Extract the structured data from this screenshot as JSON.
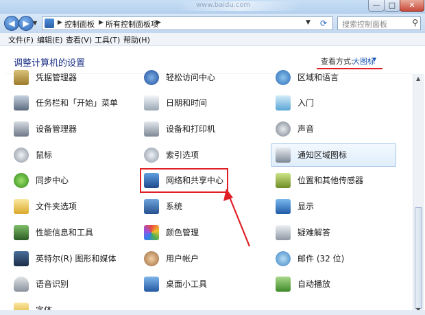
{
  "window": {
    "blurred_title": "www.baidu.com",
    "controls": {
      "minimize": "—",
      "maximize": "□",
      "close": "✕"
    }
  },
  "address_bar": {
    "crumbs": [
      "控制面板",
      "所有控制面板项"
    ],
    "search_placeholder": "搜索控制面板"
  },
  "menu": [
    "文件(F)",
    "编辑(E)",
    "查看(V)",
    "工具(T)",
    "帮助(H)"
  ],
  "page": {
    "heading": "调整计算机的设置",
    "view_by_label": "查看方式:",
    "view_by_value": "大图标"
  },
  "items": {
    "c1": [
      "凭据管理器",
      "任务栏和「开始」菜单",
      "设备管理器",
      "鼠标",
      "同步中心",
      "文件夹选项",
      "性能信息和工具",
      "英特尔(R) 图形和媒体",
      "语音识别",
      "字体"
    ],
    "c2": [
      "轻松访问中心",
      "日期和时间",
      "设备和打印机",
      "索引选项",
      "网络和共享中心",
      "系统",
      "颜色管理",
      "用户帐户",
      "桌面小工具"
    ],
    "c3": [
      "区域和语言",
      "入门",
      "声音",
      "通知区域图标",
      "位置和其他传感器",
      "显示",
      "疑难解答",
      "邮件 (32 位)",
      "自动播放"
    ]
  },
  "colors": {
    "accent": "#1e5bb5",
    "annotation_red": "#e01f26",
    "heading": "#1e3287"
  }
}
